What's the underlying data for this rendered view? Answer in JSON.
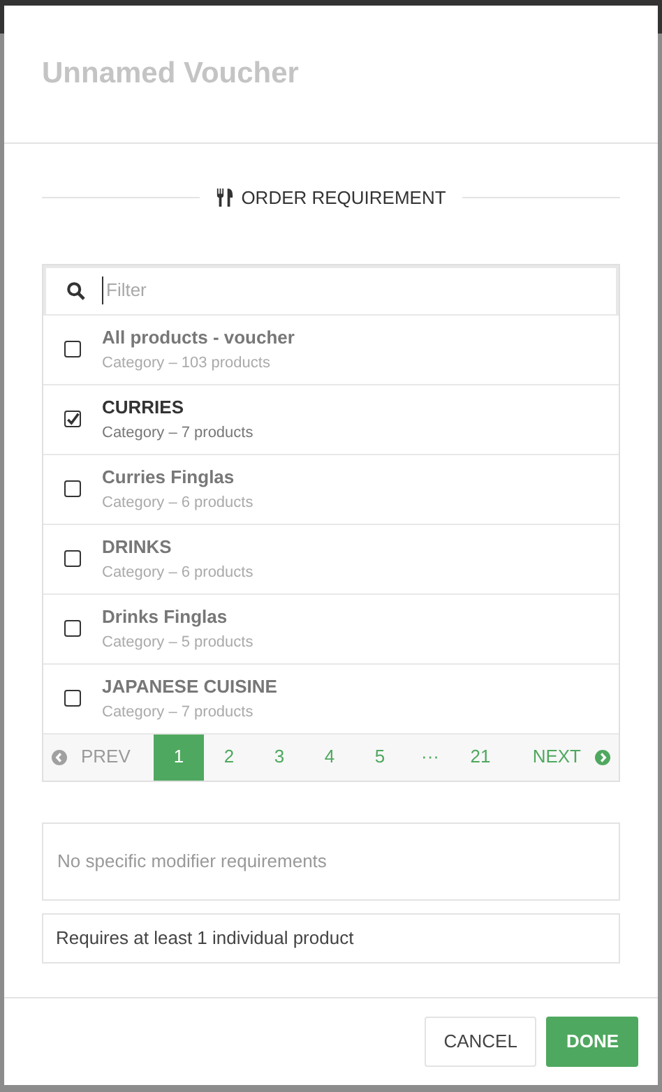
{
  "dialog": {
    "title": "Unnamed Voucher"
  },
  "section": {
    "heading": "ORDER REQUIREMENT"
  },
  "filter": {
    "placeholder": "Filter"
  },
  "products": [
    {
      "name": "All products - voucher",
      "detail": "Category – 103 products",
      "checked": false
    },
    {
      "name": "CURRIES",
      "detail": "Category – 7 products",
      "checked": true
    },
    {
      "name": "Curries Finglas",
      "detail": "Category – 6 products",
      "checked": false
    },
    {
      "name": "DRINKS",
      "detail": "Category – 6 products",
      "checked": false
    },
    {
      "name": "Drinks Finglas",
      "detail": "Category – 5 products",
      "checked": false
    },
    {
      "name": "JAPANESE CUISINE",
      "detail": "Category – 7 products",
      "checked": false
    }
  ],
  "pagination": {
    "prev": {
      "label": "PREV",
      "disabled": true
    },
    "pages": [
      {
        "label": "1",
        "selected": true
      },
      {
        "label": "2",
        "selected": false
      },
      {
        "label": "3",
        "selected": false
      },
      {
        "label": "4",
        "selected": false
      },
      {
        "label": "5",
        "selected": false
      },
      {
        "label": "···",
        "selected": false
      },
      {
        "label": "21",
        "selected": false
      }
    ],
    "next": {
      "label": "NEXT",
      "disabled": false
    }
  },
  "modifier_note": "No specific modifier requirements",
  "requirement_note": "Requires at least 1 individual product",
  "buttons": [
    {
      "label": "CANCEL",
      "kind": "secondary"
    },
    {
      "label": "DONE",
      "kind": "primary"
    }
  ]
}
